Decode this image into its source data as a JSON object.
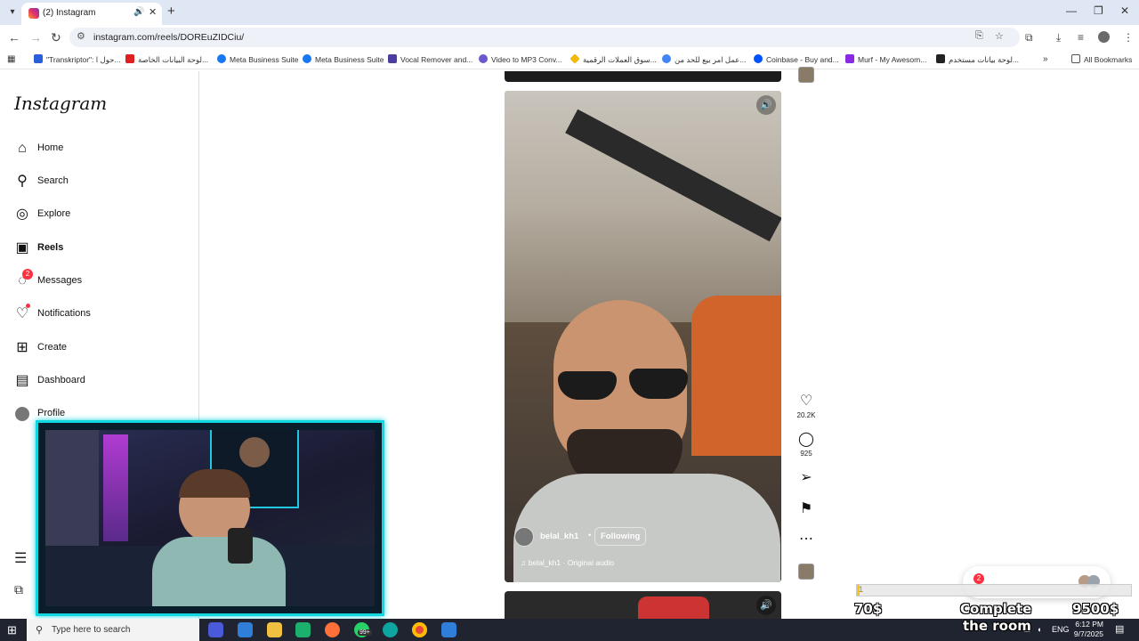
{
  "browser": {
    "tab_title": "(2) Instagram",
    "url": "instagram.com/reels/DOREuZIDCiu/",
    "all_bookmarks": "All Bookmarks",
    "bookmarks": [
      {
        "label": "\"Transkriptor\": حول ا...",
        "color": "#2b5fd9"
      },
      {
        "label": "لوحة البيانات الخاصة...",
        "color": "#e02020"
      },
      {
        "label": "Meta Business Suite",
        "color": "#1877f2"
      },
      {
        "label": "Meta Business Suite",
        "color": "#1877f2"
      },
      {
        "label": "Vocal Remover and...",
        "color": "#4a3fa0"
      },
      {
        "label": "Video to MP3 Conv...",
        "color": "#6a5acd"
      },
      {
        "label": "سوق العملات الرقمية...",
        "color": "#f0b90b"
      },
      {
        "label": "عمل امر بيع للحد من...",
        "color": "#4285f4"
      },
      {
        "label": "Coinbase - Buy and...",
        "color": "#0052ff"
      },
      {
        "label": "Murf - My Awesom...",
        "color": "#8a2be2"
      },
      {
        "label": "لوحة بيانات مستخدم...",
        "color": "#222222"
      }
    ]
  },
  "instagram": {
    "logo": "Instagram",
    "nav": [
      {
        "label": "Home",
        "icon": "home-icon"
      },
      {
        "label": "Search",
        "icon": "search-icon"
      },
      {
        "label": "Explore",
        "icon": "compass-icon"
      },
      {
        "label": "Reels",
        "icon": "reels-icon"
      },
      {
        "label": "Messages",
        "icon": "messenger-icon",
        "badge": "2"
      },
      {
        "label": "Notifications",
        "icon": "heart-icon"
      },
      {
        "label": "Create",
        "icon": "plus-square-icon"
      },
      {
        "label": "Dashboard",
        "icon": "dashboard-icon"
      },
      {
        "label": "Profile",
        "icon": "avatar"
      }
    ]
  },
  "reel": {
    "username": "belal_kh1",
    "separator": "•",
    "follow_state": "Following",
    "audio": "belal_kh1 · Original audio",
    "likes": "20.2K",
    "comments": "925"
  },
  "overlay": {
    "message_badge": "2",
    "min_amount": "70$",
    "goal_label_1": "Complete",
    "goal_label_2": "the room",
    "max_amount": "9500$",
    "progress_text": "1",
    "progress_fraction": 0.0001
  },
  "taskbar": {
    "search_placeholder": "Type here to search",
    "badge": "99+",
    "lang": "ENG",
    "time": "6:12 PM",
    "date": "9/7/2025"
  },
  "colors": {
    "accent_cyan": "#12d6e0",
    "notification_red": "#ff3040",
    "progress_yellow": "#f5c518"
  }
}
